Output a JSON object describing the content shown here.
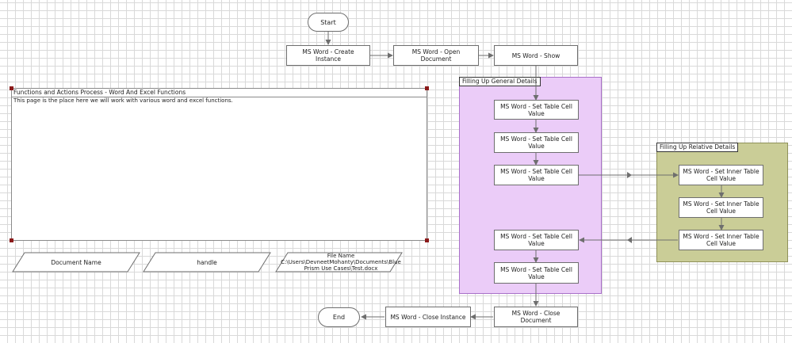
{
  "colors": {
    "general_block": "#ebccf8",
    "general_border": "#a970c9",
    "relative_block": "#cacd97",
    "relative_border": "#8f9159",
    "connector": "#6e6e6e",
    "handle": "#8b1a1a"
  },
  "terminals": {
    "start": "Start",
    "end": "End"
  },
  "stages": {
    "create_instance": "MS Word - Create Instance",
    "open_document": "MS Word - Open Document",
    "show": "MS Word - Show",
    "set_cell_1": "MS Word - Set Table Cell Value",
    "set_cell_2": "MS Word - Set Table Cell Value",
    "set_cell_3": "MS Word - Set Table Cell Value",
    "set_cell_4": "MS Word - Set Table Cell Value",
    "set_cell_5": "MS Word - Set Table Cell Value",
    "set_inner_1": "MS Word - Set Inner Table Cell Value",
    "set_inner_2": "MS Word - Set Inner Table Cell Value",
    "set_inner_3": "MS Word - Set Inner Table Cell Value",
    "close_document": "MS Word - Close Document",
    "close_instance": "MS Word - Close Instance"
  },
  "blocks": {
    "general": "Filling Up General Details",
    "relative": "Filling Up Relative Details"
  },
  "note": {
    "title": "Functions and Actions Process - Word And Excel Functions",
    "body": "This page is the place here we will work with various word and excel functions."
  },
  "data_items": {
    "document_name": "Document Name",
    "handle": "handle",
    "file_name": "File Name\nC:\\Users\\DevneetMohanty\\Documents\\Blue Prism Use Cases\\Test.docx"
  }
}
